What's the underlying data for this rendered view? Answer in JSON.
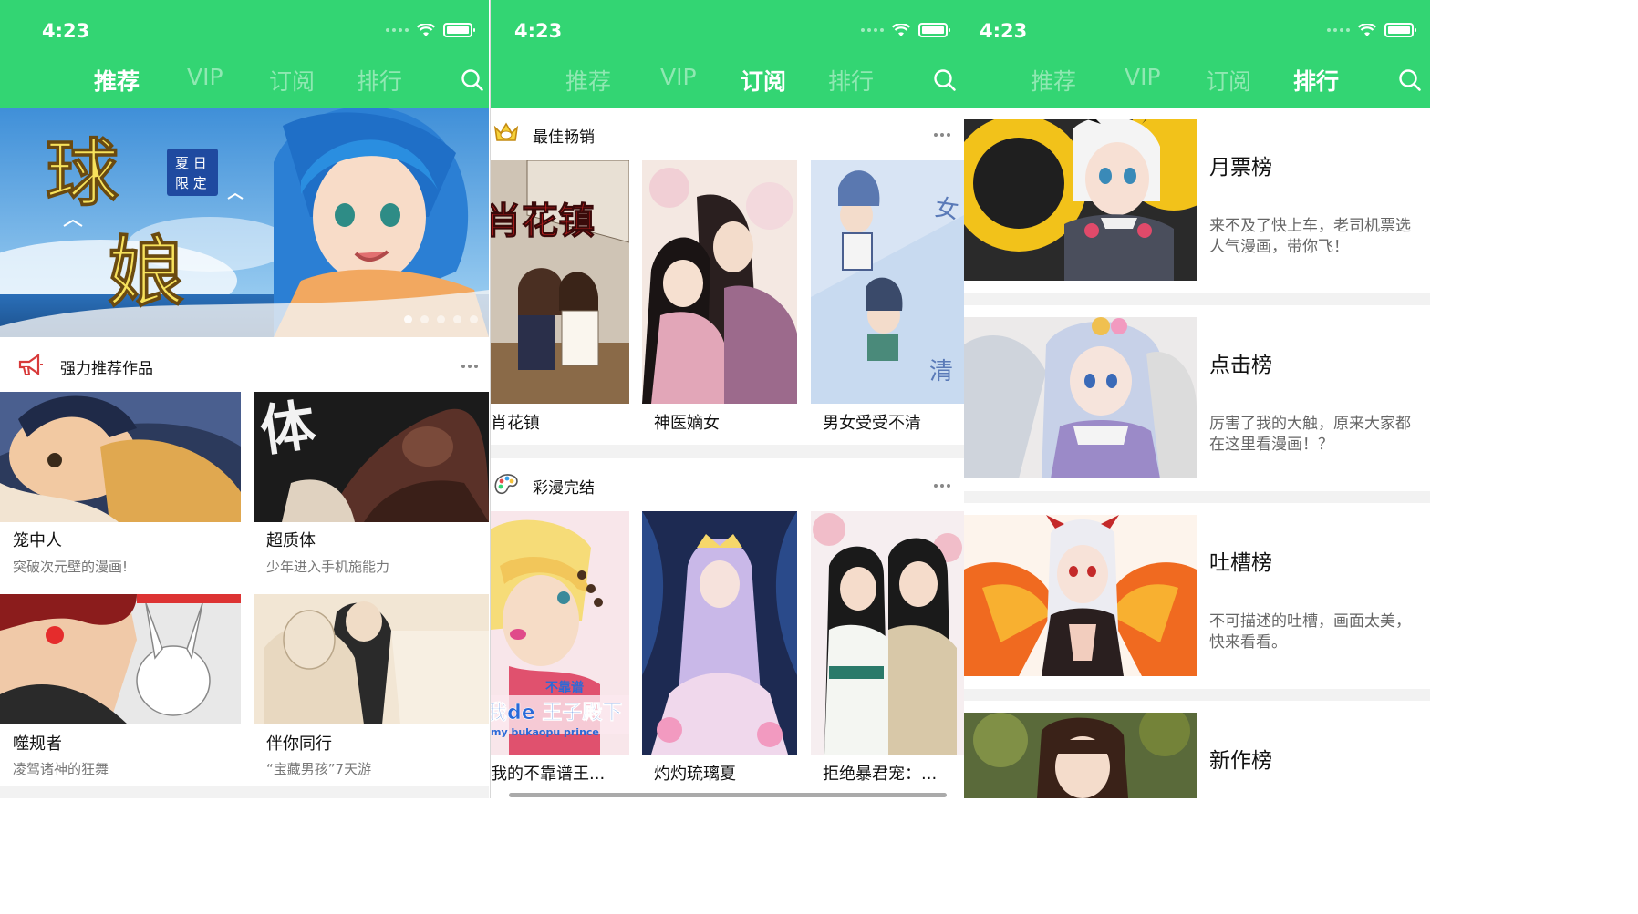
{
  "status": {
    "time": "4:23"
  },
  "tabs": [
    "推荐",
    "VIP",
    "订阅",
    "排行"
  ],
  "colors": {
    "brand": "#33d573",
    "bg": "#f2f2f2"
  },
  "screen1": {
    "banner": {
      "big_text_1": "球",
      "big_text_2": "娘",
      "badge_line1": "夏 日",
      "badge_line2": "限 定"
    },
    "section_title": "强力推荐作品",
    "section_icon": "megaphone-icon",
    "cards": [
      {
        "title": "笼中人",
        "subtitle": "突破次元壁的漫画!"
      },
      {
        "title": "超质体",
        "subtitle": "少年进入手机施能力"
      },
      {
        "title": "噬规者",
        "subtitle": "凌驾诸神的狂舞"
      },
      {
        "title": "伴你同行",
        "subtitle": "“宝藏男孩”7天游"
      }
    ]
  },
  "screen2": {
    "sections": [
      {
        "title": "最佳畅销",
        "icon": "crown-icon",
        "items": [
          {
            "title": "肖花镇"
          },
          {
            "title": "神医嫡女"
          },
          {
            "title": "男女受受不清"
          }
        ]
      },
      {
        "title": "彩漫完结",
        "icon": "palette-icon",
        "items": [
          {
            "title": "我的不靠谱王..."
          },
          {
            "title": "灼灼琉璃夏"
          },
          {
            "title": "拒绝暴君宠：..."
          }
        ]
      }
    ],
    "cover_text_1": "肖花镇",
    "cover_text_2": "不靠谱",
    "cover_text_3": "我de 王子殿下",
    "cover_text_4": "my bukaopu prince"
  },
  "screen3": {
    "ranks": [
      {
        "title": "月票榜",
        "desc": "来不及了快上车，老司机票选人气漫画，带你飞！"
      },
      {
        "title": "点击榜",
        "desc": "厉害了我的大触，原来大家都在这里看漫画！？"
      },
      {
        "title": "吐槽榜",
        "desc": "不可描述的吐槽，画面太美，快来看看。"
      },
      {
        "title": "新作榜",
        "desc": ""
      }
    ]
  }
}
